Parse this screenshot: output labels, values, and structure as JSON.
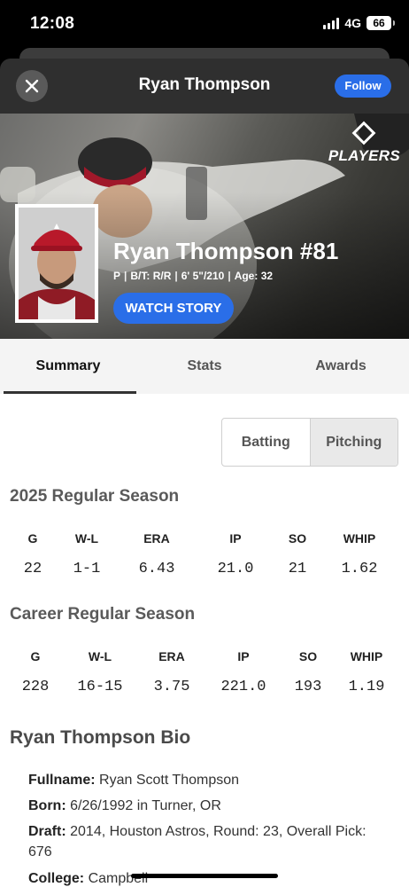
{
  "status_bar": {
    "time": "12:08",
    "network": "4G",
    "battery": "66"
  },
  "nav": {
    "title": "Ryan Thompson",
    "follow_label": "Follow"
  },
  "hero": {
    "logo_text": "PLAYERS",
    "logo_small": "MLB",
    "name": "Ryan Thompson #81",
    "meta": [
      "P",
      "B/T: R/R",
      "6' 5\"/210",
      "Age: 32"
    ],
    "watch_label": "WATCH STORY"
  },
  "tabs": [
    "Summary",
    "Stats",
    "Awards"
  ],
  "toggle": {
    "batting": "Batting",
    "pitching": "Pitching"
  },
  "season": {
    "title": "2025 Regular Season",
    "headers": [
      "G",
      "W-L",
      "ERA",
      "IP",
      "SO",
      "WHIP"
    ],
    "values": [
      "22",
      "1-1",
      "6.43",
      "21.0",
      "21",
      "1.62"
    ]
  },
  "career": {
    "title": "Career Regular Season",
    "headers": [
      "G",
      "W-L",
      "ERA",
      "IP",
      "SO",
      "WHIP"
    ],
    "values": [
      "228",
      "16-15",
      "3.75",
      "221.0",
      "193",
      "1.19"
    ]
  },
  "bio": {
    "title": "Ryan Thompson Bio",
    "fullname_label": "Fullname:",
    "fullname": "Ryan Scott Thompson",
    "born_label": "Born:",
    "born": "6/26/1992 in Turner, OR",
    "draft_label": "Draft:",
    "draft": "2014, Houston Astros, Round: 23, Overall Pick: 676",
    "college_label": "College:",
    "college": "Campbell"
  },
  "colors": {
    "accent": "#2a6ee8",
    "nav_bg": "#2f2f2f",
    "tab_bg": "#f4f4f4"
  }
}
